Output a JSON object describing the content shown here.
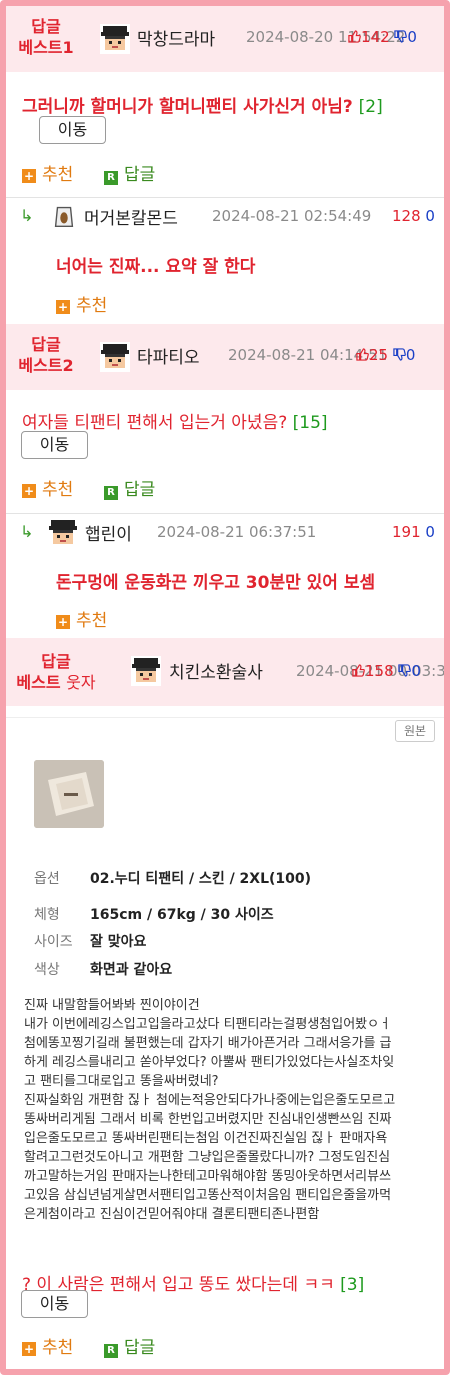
{
  "comments": [
    {
      "best_line1": "답글",
      "best_line2": "베스트1",
      "nick": "막창드라마",
      "date": "2024-08-20 11:54:22",
      "up": "142",
      "down": "0",
      "title": "그러니까 할머니가 할머니팬티 사가신거 아님?",
      "count": "[2]",
      "move_label": "이동",
      "recommend_label": "추천",
      "reply_label": "답글"
    },
    {
      "nick": "머거본칼몬드",
      "date": "2024-08-21 02:54:49",
      "up": "128",
      "down": "0",
      "text": "너어는 진짜... 요약 잘 한다",
      "recommend_label": "추천"
    },
    {
      "best_line1": "답글",
      "best_line2": "베스트2",
      "nick": "타파티오",
      "date": "2024-08-21 04:14:51",
      "up": "25",
      "down": "0",
      "title": "여자들 티팬티 편해서 입는거 아녔음?",
      "count": "[15]",
      "move_label": "이동",
      "recommend_label": "추천",
      "reply_label": "답글"
    },
    {
      "nick": "햅린이",
      "date": "2024-08-21 06:37:51",
      "up": "191",
      "down": "0",
      "text": "돈구멍에 운동화끈 끼우고 30분만 있어 보셈",
      "recommend_label": "추천"
    },
    {
      "best_line1": "답글",
      "best_line2": "베스트",
      "best_tag": "웃자",
      "nick": "치킨소환술사",
      "date": "2024-08-21 00:03:37",
      "up": "158",
      "down": "0",
      "source_label": "원본",
      "options": [
        {
          "key": "옵션",
          "value": "02.누디 티팬티 / 스킨 / 2XL(100)"
        },
        {
          "key": "체형",
          "value": "165cm / 67kg / 30 사이즈"
        },
        {
          "key": "사이즈",
          "value": "잘 맞아요"
        },
        {
          "key": "색상",
          "value": "화면과 같아요"
        }
      ],
      "review_lines": [
        "진짜 내말함들어봐봐 찐이야이건",
        "내가 이번에레깅스입고입을라고샀다 티팬티라는걸평생첨입어봤ㅇㅓ",
        "첨에똥꼬찡기길래 불편했는데 갑자기 배가아픈거라 그래서응가를 급",
        "하게 레깅스를내리고 쏟아부었다? 아뿔싸 팬티가있었다는사실조차잊",
        "고 팬티를그대로입고 똥을싸버렸네?",
        "진짜실화임 개편함 짆ㅏ 첨에는적응안되다가나중에는입은줄도모르고",
        "똥싸버리게됨 그래서 비록 한번입고버렸지만 진심내인생빤쓰임 진짜",
        "입은줄도모르고 똥싸버린팬티는첨임 이건진짜진실임 짆ㅏ 판매자욕",
        "할려고그런것도아니고 개편함 그냥입은줄몰랐다니까? 그정도임진심",
        "까고말하는거임 판매자는나한테고마워해야함 똥밍아웃하면서리뷰쓰",
        "고있음 삼십년넘게살면서팬티입고똥산적이처음임 팬티입은줄을까먹",
        "은게첨이라고 진심이건믿어줘야대 결론티팬티존나편함"
      ],
      "title": "? 이 사람은 편해서 입고 똥도 쌌다는데 ㅋㅋ",
      "count": "[3]",
      "move_label": "이동",
      "recommend_label": "추천",
      "reply_label": "답글"
    }
  ],
  "reply_arrow": "↳",
  "colors": {
    "accent_red": "#e0242f",
    "header_bg": "#fde9ec",
    "border_pink": "#f6a2ad",
    "count_green": "#1e9a1e",
    "down_blue": "#1a3fc6"
  }
}
